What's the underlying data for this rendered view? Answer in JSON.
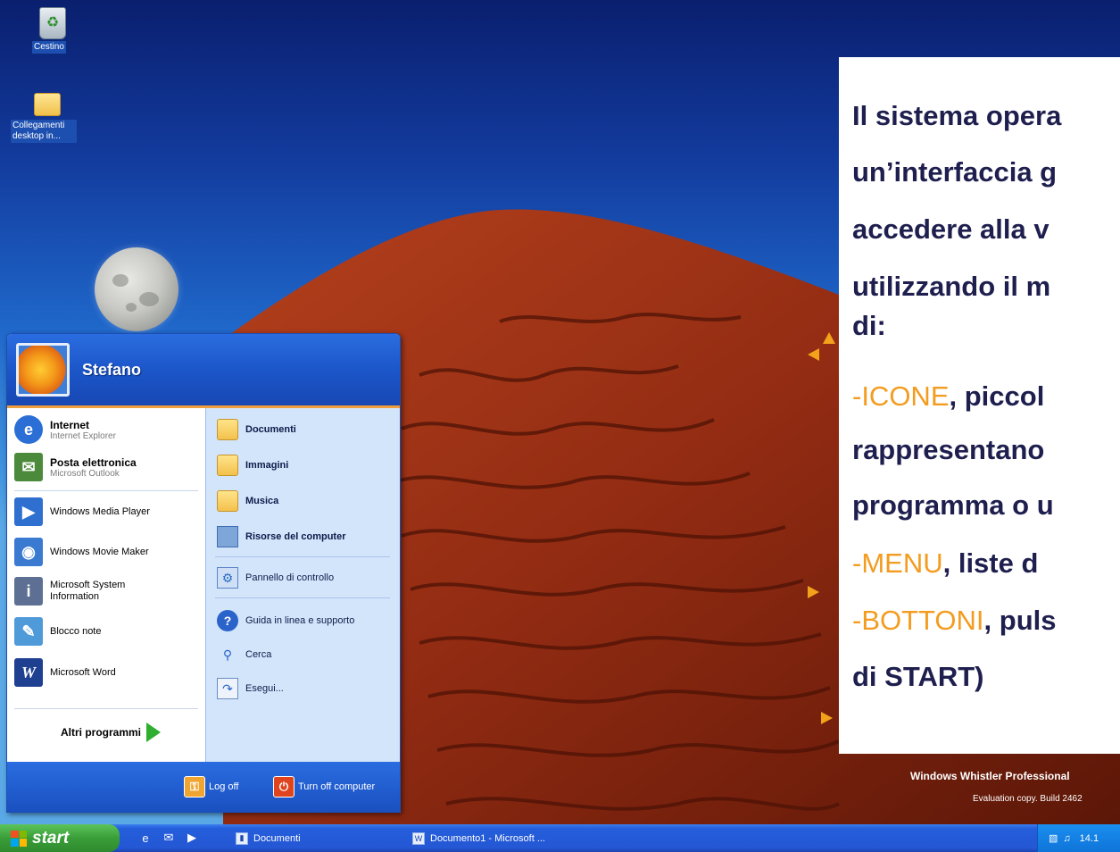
{
  "desktop": {
    "icons": [
      {
        "label": "Cestino",
        "icon": "recycle-bin-icon"
      },
      {
        "label": "Collegamenti desktop in...",
        "icon": "folder-icon"
      }
    ],
    "watermark": "Windows Whistler Professional",
    "watermark_sub": "Evaluation copy. Build 2462"
  },
  "start_menu": {
    "username": "Stefano",
    "pinned": [
      {
        "title": "Internet",
        "subtitle": "Internet Explorer",
        "icon": "internet-explorer-icon",
        "color": "#2b6fd6"
      },
      {
        "title": "Posta elettronica",
        "subtitle": "Microsoft Outlook",
        "icon": "outlook-icon",
        "color": "#4a8a3a"
      }
    ],
    "recent": [
      {
        "label": "Windows Media Player",
        "icon": "media-player-icon",
        "color": "#2f6fd0"
      },
      {
        "label": "Windows Movie Maker",
        "icon": "movie-maker-icon",
        "color": "#3a7bd1"
      },
      {
        "label": "Microsoft System Information",
        "icon": "system-information-icon",
        "color": "#5d6f92"
      },
      {
        "label": "Blocco note",
        "icon": "notepad-icon",
        "color": "#4f9ad8"
      },
      {
        "label": "Microsoft Word",
        "icon": "word-icon",
        "color": "#1f3f91"
      }
    ],
    "all_programs": "Altri programmi",
    "right": [
      {
        "label": "Documenti",
        "bold": true,
        "icon": "documents-folder-icon"
      },
      {
        "label": "Immagini",
        "bold": true,
        "icon": "pictures-folder-icon"
      },
      {
        "label": "Musica",
        "bold": true,
        "icon": "music-folder-icon"
      },
      {
        "label": "Risorse del computer",
        "bold": true,
        "icon": "my-computer-icon"
      },
      {
        "label": "Pannello di controllo",
        "bold": false,
        "icon": "control-panel-icon"
      },
      {
        "label": "Guida in linea e supporto",
        "bold": false,
        "icon": "help-icon"
      },
      {
        "label": "Cerca",
        "bold": false,
        "icon": "search-icon"
      },
      {
        "label": "Esegui...",
        "bold": false,
        "icon": "run-icon"
      }
    ],
    "logoff": "Log off",
    "turnoff": "Turn off computer"
  },
  "taskbar": {
    "start_label": "start",
    "tasks": [
      {
        "label": "Documenti",
        "icon": "folder-icon"
      },
      {
        "label": "Documento1 - Microsoft ...",
        "icon": "word-document-icon"
      }
    ],
    "clock": "14.1"
  },
  "overlay": {
    "line1": "Il sistema opera",
    "line2": "un’interfaccia g",
    "line3": "accedere alla v",
    "line4": "utilizzando il m",
    "line5": "di:",
    "icone_key": "-ICONE",
    "icone_rest": ", piccol",
    "line7": "rappresentano",
    "line8": "programma o u",
    "menu_key": "-MENU",
    "menu_rest": ",  liste d",
    "bottoni_key": "-BOTTONI",
    "bottoni_rest": ", puls",
    "line11": " di START)"
  },
  "colors": {
    "accent": "#f39c1f",
    "overlay_text": "#1f1f4f",
    "xp_blue": "#2457d4",
    "start_green": "#3a9e38"
  }
}
